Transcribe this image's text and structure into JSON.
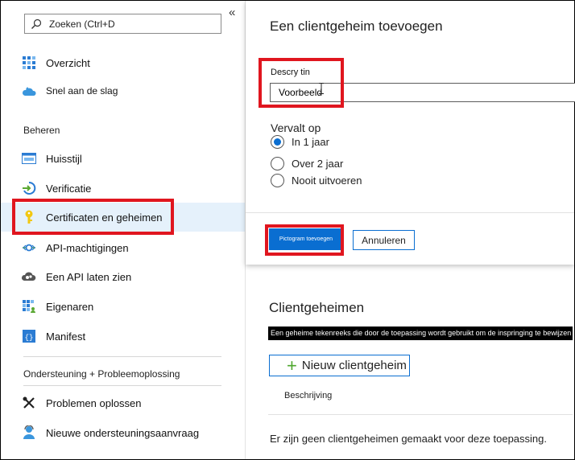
{
  "sidebar": {
    "search_placeholder": "Zoeken (Ctrl+D",
    "collapse_glyph": "«",
    "items_top": [
      {
        "label": "Overzicht",
        "icon": "grid-overview-icon"
      },
      {
        "label": "Snel aan de slag",
        "icon": "cloud-quickstart-icon"
      }
    ],
    "section_manage": "Beheren",
    "items_manage": [
      {
        "label": "Huisstijl",
        "icon": "branding-window-icon"
      },
      {
        "label": "Verificatie",
        "icon": "authentication-arrow-icon"
      },
      {
        "label": "Certificaten en geheimen",
        "icon": "key-icon",
        "active": true
      },
      {
        "label": "API-machtigingen",
        "icon": "api-permissions-icon"
      },
      {
        "label": "Een API laten zien",
        "icon": "expose-api-cloud-icon"
      },
      {
        "label": "Eigenaren",
        "icon": "owners-grid-icon"
      },
      {
        "label": "Manifest",
        "icon": "manifest-brackets-icon"
      }
    ],
    "section_support": "Ondersteuning + Probleemoplossing",
    "items_support": [
      {
        "label": "Problemen oplossen",
        "icon": "wrench-troubleshoot-icon"
      },
      {
        "label": "Nieuwe ondersteuningsaanvraag",
        "icon": "support-person-icon"
      }
    ]
  },
  "panel": {
    "title": "Een clientgeheim toevoegen",
    "description_label": "Descry tin",
    "description_value": "Voorbeeld",
    "expires_label": "Vervalt op",
    "options": [
      {
        "label": "In 1 jaar",
        "selected": true
      },
      {
        "label": "Over 2 jaar",
        "selected": false
      },
      {
        "label": "Nooit uitvoeren",
        "selected": false
      }
    ],
    "add_button": "Pictogram toevoegen",
    "cancel_button": "Annuleren"
  },
  "content": {
    "title": "Clientgeheimen",
    "info_text": "Een geheime tekenreeks die door de toepassing wordt gebruikt om de inspringing te bewijzen",
    "new_secret_button": "Nieuw clientgeheim",
    "column_header": "Beschrijving",
    "empty_message": "Er zijn geen clientgeheimen gemaakt voor deze toepassing."
  },
  "colors": {
    "accent": "#0a6ed1",
    "highlight": "#e0161f",
    "active_bg": "#e5f1fb",
    "plus": "#4ea72e"
  }
}
